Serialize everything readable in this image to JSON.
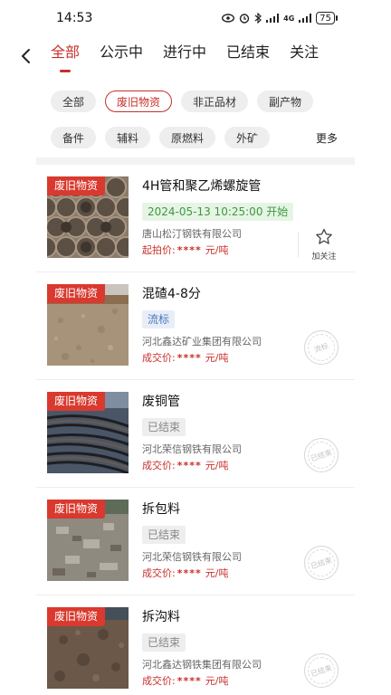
{
  "status_bar": {
    "time": "14:53",
    "network": "4G",
    "battery": "75"
  },
  "top_tabs": [
    "全部",
    "公示中",
    "进行中",
    "已结束",
    "关注"
  ],
  "active_tab": 0,
  "filters": {
    "row1": [
      "全部",
      "废旧物资",
      "非正品材",
      "副产物"
    ],
    "row2": [
      "备件",
      "辅料",
      "原燃料",
      "外矿"
    ],
    "more": "更多",
    "active": "废旧物资"
  },
  "items": [
    {
      "tag": "废旧物资",
      "title": "4H管和聚乙烯螺旋管",
      "status": "2024-05-13 10:25:00 开始",
      "company": "唐山松汀钢铁有限公司",
      "price_label": "起拍价:",
      "price_mask": "****",
      "price_unit": "元/吨",
      "follow_label": "加关注"
    },
    {
      "tag": "废旧物资",
      "title": "混碴4-8分",
      "status": "流标",
      "company": "河北鑫达矿业集团有限公司",
      "price_label": "成交价:",
      "price_mask": "****",
      "price_unit": "元/吨",
      "stamp": "流标"
    },
    {
      "tag": "废旧物资",
      "title": "废铜管",
      "status": "已结束",
      "company": "河北荣信钢铁有限公司",
      "price_label": "成交价:",
      "price_mask": "****",
      "price_unit": "元/吨",
      "stamp": "已结束"
    },
    {
      "tag": "废旧物资",
      "title": "拆包料",
      "status": "已结束",
      "company": "河北荣信钢铁有限公司",
      "price_label": "成交价:",
      "price_mask": "****",
      "price_unit": "元/吨",
      "stamp": "已结束"
    },
    {
      "tag": "废旧物资",
      "title": "拆沟料",
      "status": "已结束",
      "company": "河北鑫达钢铁集团有限公司",
      "price_label": "成交价:",
      "price_mask": "****",
      "price_unit": "元/吨",
      "stamp": "已结束"
    }
  ]
}
